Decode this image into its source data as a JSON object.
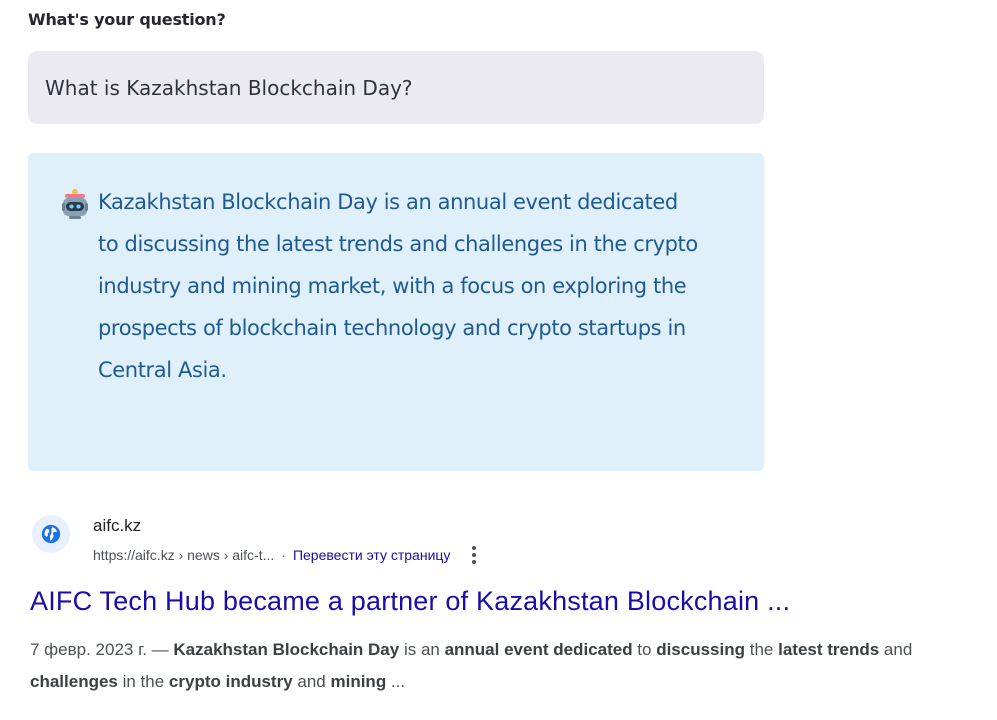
{
  "question": {
    "label": "What's your question?",
    "value": "What is Kazakhstan Blockchain Day?"
  },
  "answer": {
    "icon": "robot-icon",
    "text": "Kazakhstan Blockchain Day is an annual event dedicated to discussing the latest trends and challenges in the crypto industry and mining market, with a focus on exploring the prospects of blockchain technology and crypto startups in Central Asia."
  },
  "search_result": {
    "favicon": "globe-icon",
    "site_name": "aifc.kz",
    "url": "https://aifc.kz › news › aifc-t...",
    "separator": "·",
    "translate_link": "Перевести эту страницу",
    "title": "AIFC Tech Hub became a partner of Kazakhstan Blockchain ...",
    "snippet": {
      "date": "7 февр. 2023 г. —",
      "parts": [
        {
          "text": "Kazakhstan Blockchain Day",
          "bold": true
        },
        {
          "text": " is an ",
          "bold": false
        },
        {
          "text": "annual event dedicated",
          "bold": true
        },
        {
          "text": " to ",
          "bold": false
        },
        {
          "text": "discussing",
          "bold": true
        },
        {
          "text": " the ",
          "bold": false
        },
        {
          "text": "latest trends",
          "bold": true
        },
        {
          "text": " and ",
          "bold": false
        },
        {
          "text": "challenges",
          "bold": true
        },
        {
          "text": " in the ",
          "bold": false
        },
        {
          "text": "crypto industry",
          "bold": true
        },
        {
          "text": " and ",
          "bold": false
        },
        {
          "text": "mining",
          "bold": true
        },
        {
          "text": " ...",
          "bold": false
        }
      ]
    }
  },
  "colors": {
    "answer_text": "#1f5a92",
    "answer_bg": "#dff0fb",
    "input_bg": "#ebe9f1",
    "link": "#1a0dab"
  }
}
